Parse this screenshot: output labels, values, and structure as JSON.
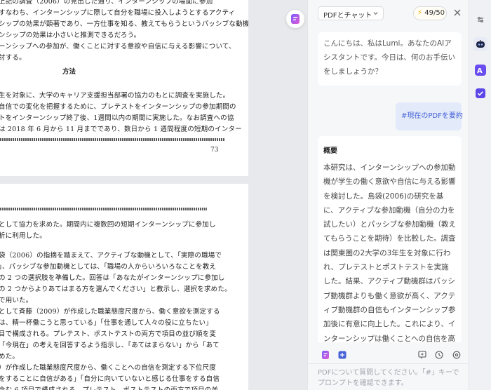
{
  "pdf": {
    "page1": {
      "lines": [
        "上記の調査（2006）の見出した通り、インターンシップの場面に参加",
        "すなわち、インターンシップに際して自分を職場に投入しようとするアクティ",
        "シップの効果が顕著であり、一方仕事を知る、教えてもらうというパッシブな動機",
        "ンシップの効果は小さいと推測できるだろう。",
        "ーンシップへの参加が、働くことに対する意欲や自信に与える影響について、",
        "討する。"
      ],
      "heading": "方法",
      "method_lines": [
        "生を対象に、大学のキャリア支援担当部署の協力のもとに調査を実施した。",
        "自信での変化を把握するために、プレテストをインターンシップの参加期間の",
        "トをインターンシップ終了後、1週間以内の期間に実施した。なお調査への協",
        "は 2018 年 6 月から 11 月までであり、数日から 1 週間程度の短期のインター"
      ],
      "page_number": "73"
    },
    "page2": {
      "lines_a": [
        "として協力を求めた。期間内に複数回の短期インターンシップに参加し",
        "析に利用した。"
      ],
      "lines_b": [
        "袋（2006）の指摘を踏まえて、アクティブな動機として、「実際の職場で",
        "」、パッシブな参加動機としては、「職場の人からいろいろなことを教え",
        "の 2 つの選択肢を準備した。回答は「あなたがインターンシップに参加し",
        "の 2 つからよりあてはまる方を選んでください」と教示し、選択を求めた。",
        "で用いた。",
        "として斉藤（2009）が作成した職業態度尺度から、働く意欲を測定する",
        "は、精一杯働こうと思っている」「仕事を通して人々の役に立ちたい」",
        "目で構成される。プレテスト、ポストテストの両方で項目の並び順を変",
        "「今現在」の考えを回答するよう指示し、「あてはまらない」から「あて",
        "めた。",
        "）が作成した職業態度尺度から、働くことへの自信を測定する下位尺度",
        "をすることに自信がある」「自分に向いていないと感じる仕事をする自信",
        "含む 6 項目で構成される。プレテスト、ポストテストの両方で項目の並",
        "「…」「今現在」の考えを回答するよう指示し、「あてはまらない」"
      ]
    }
  },
  "panel": {
    "mode_label": "PDFとチャット",
    "credits": "49/50",
    "greeting": "こんにちは、私はLumi。あなたのAIアシスタントです。今日は、何のお手伝いをしましょうか？",
    "user_message": "#現在のPDFを要約",
    "summary_title": "概要",
    "summary_body": "本研究は、インターンシップへの参加動機が学生の働く意欲や自信に与える影響を検討した。島袋(2006)の研究を基に、アクティブな参加動機（自分の力を試したい）とパッシブな参加動機（教えてもらうことを期待）を比較した。調査は関東圏の2大学の3年生を対象に行われ、プレテストとポストテストを実施した。結果、アクティブ動機群はパッシブ動機群よりも働く意欲が高く、アクティブ動機群の自信もインターンシップ参加後に有意に向上した。これにより、インターンシップは働くことへの自信を高める効果があることが示された。特に、実際の職場で自分の力を試すことを目的とした参加が、学生の成長に寄与することが確認された。",
    "input_placeholder": "PDFについて質問してください。「#」キーでプロンプトを確認できます。"
  },
  "icons": {
    "float": "app-logo-icon",
    "rail": [
      "lumi-robot-icon",
      "translate-icon",
      "checklist-icon"
    ],
    "toolbar_left": [
      "pdf-doc-icon",
      "screenshot-icon"
    ],
    "toolbar_right": [
      "new-chat-icon",
      "history-icon",
      "settings-icon"
    ]
  },
  "colors": {
    "accent": "#4763d8",
    "brand_purple": "#6a4dee",
    "user_bubble": "#e3eafa",
    "credit_bolt": "#f2a600"
  }
}
